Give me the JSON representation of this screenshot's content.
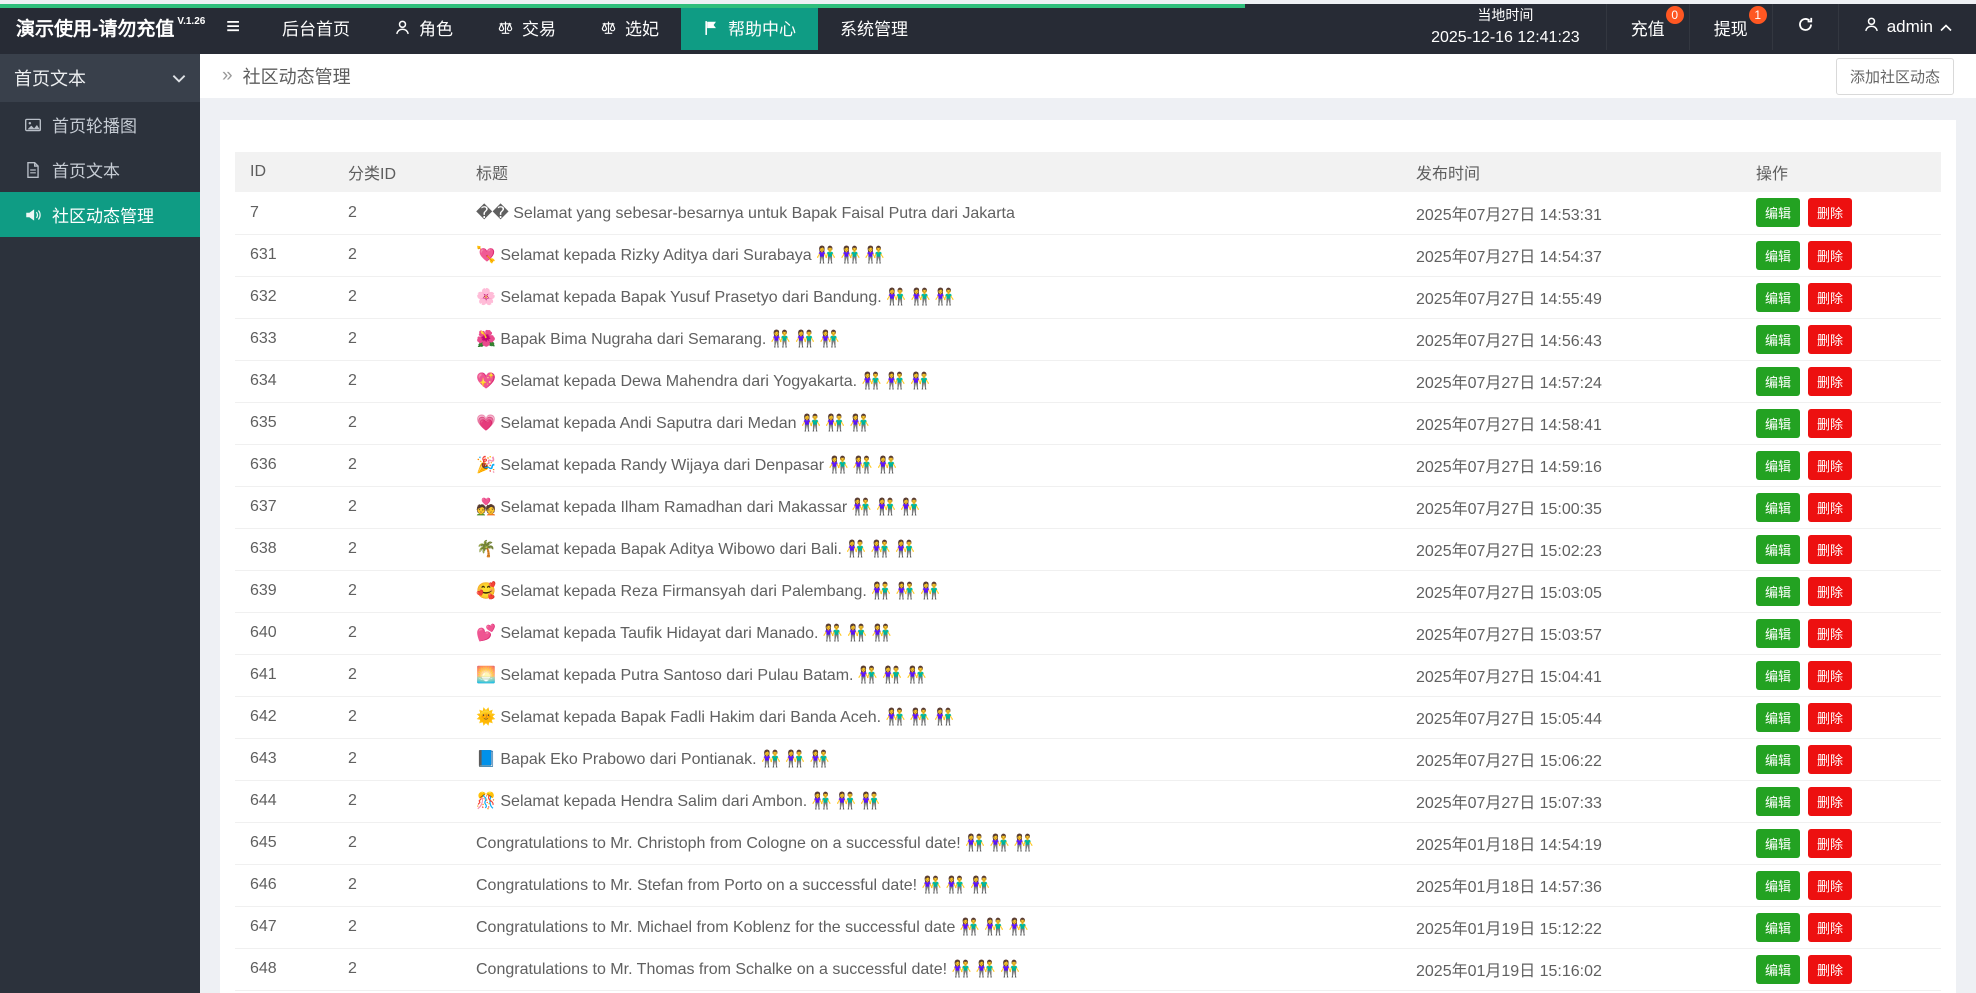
{
  "topbar": {
    "logo": "演示使用-请勿充值",
    "version": "V.1.26",
    "menu": [
      {
        "label": "后台首页",
        "icon": "",
        "active": false
      },
      {
        "label": "角色",
        "icon": "person",
        "active": false
      },
      {
        "label": "交易",
        "icon": "scales",
        "active": false
      },
      {
        "label": "选妃",
        "icon": "scales",
        "active": false
      },
      {
        "label": "帮助中心",
        "icon": "flag",
        "active": true
      },
      {
        "label": "系统管理",
        "icon": "",
        "active": false
      }
    ],
    "local_time_label": "当地时间",
    "local_time_value": "2025-12-16 12:41:23",
    "recharge_label": "充值",
    "recharge_badge": "0",
    "withdraw_label": "提现",
    "withdraw_badge": "1",
    "username": "admin"
  },
  "sidebar": {
    "section_title": "首页文本",
    "items": [
      {
        "label": "首页轮播图",
        "icon": "image",
        "active": false
      },
      {
        "label": "首页文本",
        "icon": "doc",
        "active": false
      },
      {
        "label": "社区动态管理",
        "icon": "speaker",
        "active": true
      }
    ]
  },
  "breadcrumb": "社区动态管理",
  "add_button_label": "添加社区动态",
  "table": {
    "columns": [
      "ID",
      "分类ID",
      "标题",
      "发布时间",
      "操作"
    ],
    "edit_label": "编辑",
    "delete_label": "删除",
    "rows": [
      {
        "id": "7",
        "category": "2",
        "title": "�� Selamat yang sebesar-besarnya untuk Bapak Faisal Putra dari Jakarta",
        "time": "2025年07月27日 14:53:31"
      },
      {
        "id": "631",
        "category": "2",
        "title": "💘 Selamat kepada Rizky Aditya dari Surabaya 👫 👫 👫",
        "time": "2025年07月27日 14:54:37"
      },
      {
        "id": "632",
        "category": "2",
        "title": "🌸 Selamat kepada Bapak Yusuf Prasetyo dari Bandung. 👫 👫 👫",
        "time": "2025年07月27日 14:55:49"
      },
      {
        "id": "633",
        "category": "2",
        "title": "🌺 Bapak Bima Nugraha dari Semarang. 👫 👫 👫",
        "time": "2025年07月27日 14:56:43"
      },
      {
        "id": "634",
        "category": "2",
        "title": "💖 Selamat kepada Dewa Mahendra dari Yogyakarta. 👫 👫 👫",
        "time": "2025年07月27日 14:57:24"
      },
      {
        "id": "635",
        "category": "2",
        "title": "💗 Selamat kepada Andi Saputra dari Medan 👫 👫 👫",
        "time": "2025年07月27日 14:58:41"
      },
      {
        "id": "636",
        "category": "2",
        "title": "🎉 Selamat kepada Randy Wijaya dari Denpasar 👫 👫 👫",
        "time": "2025年07月27日 14:59:16"
      },
      {
        "id": "637",
        "category": "2",
        "title": "💑 Selamat kepada Ilham Ramadhan dari Makassar 👫 👫 👫",
        "time": "2025年07月27日 15:00:35"
      },
      {
        "id": "638",
        "category": "2",
        "title": "🌴 Selamat kepada Bapak Aditya Wibowo dari Bali. 👫 👫 👫",
        "time": "2025年07月27日 15:02:23"
      },
      {
        "id": "639",
        "category": "2",
        "title": "🥰 Selamat kepada Reza Firmansyah dari Palembang. 👫 👫 👫",
        "time": "2025年07月27日 15:03:05"
      },
      {
        "id": "640",
        "category": "2",
        "title": "💕 Selamat kepada Taufik Hidayat dari Manado. 👫 👫 👫",
        "time": "2025年07月27日 15:03:57"
      },
      {
        "id": "641",
        "category": "2",
        "title": "🌅 Selamat kepada Putra Santoso dari Pulau Batam. 👫 👫 👫",
        "time": "2025年07月27日 15:04:41"
      },
      {
        "id": "642",
        "category": "2",
        "title": "🌞 Selamat kepada Bapak Fadli Hakim dari Banda Aceh. 👫 👫 👫",
        "time": "2025年07月27日 15:05:44"
      },
      {
        "id": "643",
        "category": "2",
        "title": "📘 Bapak Eko Prabowo dari Pontianak. 👫 👫 👫",
        "time": "2025年07月27日 15:06:22"
      },
      {
        "id": "644",
        "category": "2",
        "title": "🎊 Selamat kepada Hendra Salim dari Ambon. 👫 👫 👫",
        "time": "2025年07月27日 15:07:33"
      },
      {
        "id": "645",
        "category": "2",
        "title": "Congratulations to Mr. Christoph from Cologne on a successful date! 👫 👫 👫",
        "time": "2025年01月18日 14:54:19"
      },
      {
        "id": "646",
        "category": "2",
        "title": "Congratulations to Mr. Stefan from Porto on a successful date! 👫 👫 👫",
        "time": "2025年01月18日 14:57:36"
      },
      {
        "id": "647",
        "category": "2",
        "title": "Congratulations to Mr. Michael from Koblenz for the successful date 👫 👫 👫",
        "time": "2025年01月19日 15:12:22"
      },
      {
        "id": "648",
        "category": "2",
        "title": "Congratulations to Mr. Thomas from Schalke on a successful date! 👫 👫 👫",
        "time": "2025年01月19日 15:16:02"
      }
    ]
  },
  "colors": {
    "accent": "#0f9c84",
    "edit_button": "#23a222",
    "delete_button": "#ed1010",
    "badge": "#ff5722",
    "progress_strip": "#2fbe7c",
    "topbar_bg": "#272b35",
    "sidebar_bg": "#2c323c"
  }
}
